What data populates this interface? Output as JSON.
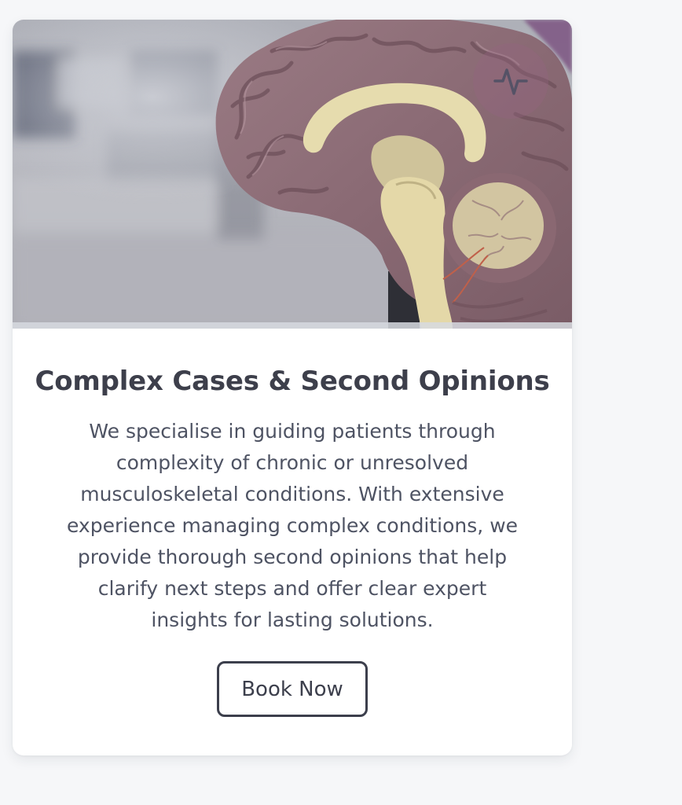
{
  "card": {
    "image": {
      "subject": "brain-model-cross-section",
      "badge_icon": "activity-pulse-icon"
    },
    "title": "Complex Cases & Second Opinions",
    "description": "We specialise in guiding patients through\ncomplexity of chronic or unresolved\nmusculoskeletal conditions. With extensive\nexperience managing complex conditions, we\nprovide thorough second opinions that help\nclarify next steps and offer clear expert\ninsights for lasting solutions.",
    "button_label": "Book Now"
  },
  "colors": {
    "page_background": "#f6f7f9",
    "card_background": "#ffffff",
    "title_text": "#3d3f4b",
    "body_text": "#4e5363",
    "button_border": "#3c3f4c"
  }
}
